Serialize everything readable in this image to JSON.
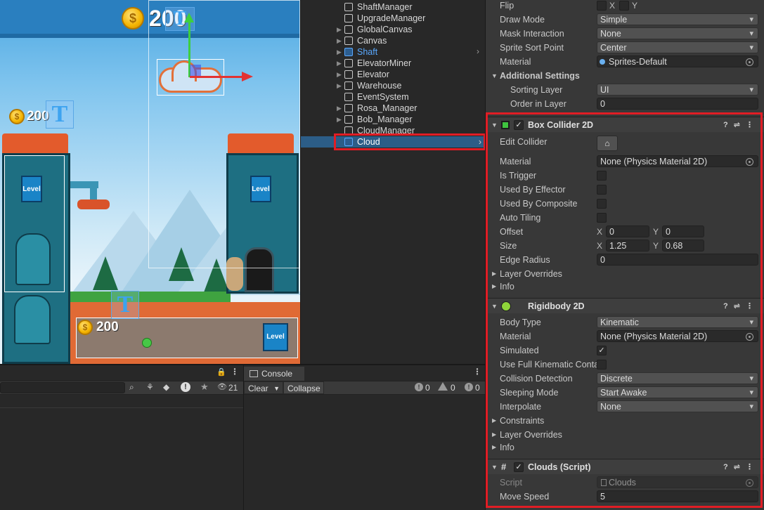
{
  "scene": {
    "top_coin_text": "200",
    "left_coin_text": "200",
    "bottom_coin_text": "200",
    "t_glyph": "T",
    "level_label": "Level"
  },
  "hierarchy": {
    "items": [
      {
        "name": "ShaftManager",
        "prefab": false,
        "arrow": false
      },
      {
        "name": "UpgradeManager",
        "prefab": false,
        "arrow": false
      },
      {
        "name": "GlobalCanvas",
        "prefab": false,
        "arrow": true
      },
      {
        "name": "Canvas",
        "prefab": false,
        "arrow": true
      },
      {
        "name": "Shaft",
        "prefab": true,
        "arrow": true
      },
      {
        "name": "ElevatorMiner",
        "prefab": false,
        "arrow": true
      },
      {
        "name": "Elevator",
        "prefab": false,
        "arrow": true
      },
      {
        "name": "Warehouse",
        "prefab": false,
        "arrow": true
      },
      {
        "name": "EventSystem",
        "prefab": false,
        "arrow": false
      },
      {
        "name": "Rosa_Manager",
        "prefab": false,
        "arrow": true
      },
      {
        "name": "Bob_Manager",
        "prefab": false,
        "arrow": true
      },
      {
        "name": "CloudManager",
        "prefab": false,
        "arrow": false
      },
      {
        "name": "Cloud",
        "prefab": true,
        "arrow": false,
        "selected": true
      }
    ]
  },
  "project": {
    "hidden_count": "21"
  },
  "console": {
    "tab": "Console",
    "clear": "Clear",
    "collapse": "Collapse",
    "log_count": "0",
    "warn_count": "0",
    "error_count": "0"
  },
  "inspector": {
    "sprite_renderer": {
      "flip_label": "Flip",
      "flip_x": "X",
      "flip_y": "Y",
      "draw_mode_label": "Draw Mode",
      "draw_mode": "Simple",
      "mask_label": "Mask Interaction",
      "mask": "None",
      "sort_point_label": "Sprite Sort Point",
      "sort_point": "Center",
      "material_label": "Material",
      "material": "Sprites-Default",
      "additional_settings": "Additional Settings",
      "sorting_layer_label": "Sorting Layer",
      "sorting_layer": "UI",
      "order_label": "Order in Layer",
      "order": "0"
    },
    "box_collider": {
      "title": "Box Collider 2D",
      "edit_collider": "Edit Collider",
      "material_label": "Material",
      "material": "None (Physics Material 2D)",
      "is_trigger": "Is Trigger",
      "used_by_effector": "Used By Effector",
      "used_by_composite": "Used By Composite",
      "auto_tiling": "Auto Tiling",
      "offset_label": "Offset",
      "offset_x": "0",
      "offset_y": "0",
      "size_label": "Size",
      "size_x": "1.25",
      "size_y": "0.68",
      "edge_radius_label": "Edge Radius",
      "edge_radius": "0",
      "layer_overrides": "Layer Overrides",
      "info": "Info"
    },
    "rigidbody": {
      "title": "Rigidbody 2D",
      "body_type_label": "Body Type",
      "body_type": "Kinematic",
      "material_label": "Material",
      "material": "None (Physics Material 2D)",
      "simulated_label": "Simulated",
      "full_kinematic_label": "Use Full Kinematic Conta",
      "collision_label": "Collision Detection",
      "collision": "Discrete",
      "sleeping_label": "Sleeping Mode",
      "sleeping": "Start Awake",
      "interpolate_label": "Interpolate",
      "interpolate": "None",
      "constraints": "Constraints",
      "layer_overrides": "Layer Overrides",
      "info": "Info"
    },
    "script": {
      "title": "Clouds (Script)",
      "script_label": "Script",
      "script_value": "Clouds",
      "move_speed_label": "Move Speed",
      "move_speed": "5"
    },
    "axis_x": "X",
    "axis_y": "Y"
  },
  "colors": {
    "highlight": "#e11d25",
    "selection": "#2c5d87",
    "prefab_blue": "#5aa9ff"
  }
}
